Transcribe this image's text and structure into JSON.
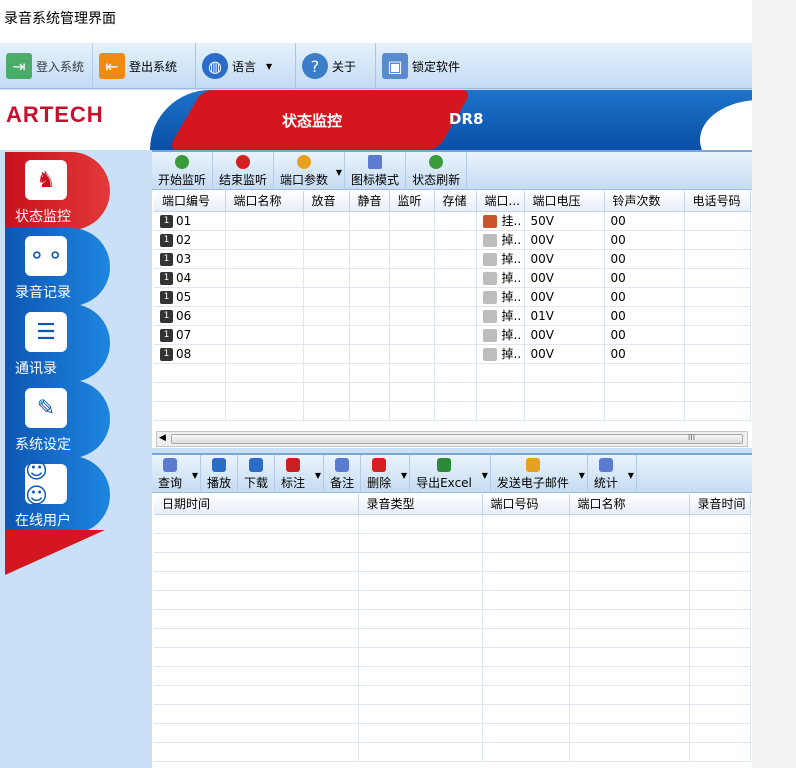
{
  "window_title": "录音系统管理界面",
  "main_toolbar": [
    {
      "label": "登入系统",
      "icon": "login-icon",
      "color": "#1e9a3a"
    },
    {
      "label": "登出系统",
      "icon": "logout-icon",
      "color": "#f08a10"
    },
    {
      "label": "语言",
      "icon": "globe-icon",
      "color": "#2a6cc8"
    },
    {
      "label": "关于",
      "icon": "help-icon",
      "color": "#3b7dc9"
    },
    {
      "label": "锁定软件",
      "icon": "lock-computer-icon",
      "color": "#5a8bd0"
    }
  ],
  "banner": {
    "logo": "ARTECH",
    "section": "状态监控",
    "model": "DR8"
  },
  "sidebar": [
    {
      "label": "状态监控",
      "icon": "status-monitor-icon"
    },
    {
      "label": "录音记录",
      "icon": "tape-icon"
    },
    {
      "label": "通讯录",
      "icon": "contacts-icon"
    },
    {
      "label": "系统设定",
      "icon": "wrench-icon"
    },
    {
      "label": "在线用户",
      "icon": "users-icon"
    }
  ],
  "monitor_toolbar": [
    {
      "label": "开始监听",
      "icon": "headset-icon",
      "color": "#3a9b3a"
    },
    {
      "label": "结束监听",
      "icon": "stop-icon",
      "color": "#d42020"
    },
    {
      "label": "端口参数",
      "icon": "gear-icon",
      "color": "#e8a020"
    },
    {
      "label": "图标模式",
      "icon": "icon-mode-icon",
      "color": "#5a7bd0"
    },
    {
      "label": "状态刷新",
      "icon": "refresh-icon",
      "color": "#3a9b3a"
    }
  ],
  "port_columns": [
    "端口编号",
    "端口名称",
    "放音",
    "静音",
    "监听",
    "存储",
    "端口...",
    "端口电压",
    "铃声次数",
    "电话号码"
  ],
  "ports": [
    {
      "no": "01",
      "status": "挂..",
      "voltage": "50V",
      "rings": "00",
      "state": "on"
    },
    {
      "no": "02",
      "status": "掉..",
      "voltage": "00V",
      "rings": "00",
      "state": "off"
    },
    {
      "no": "03",
      "status": "掉..",
      "voltage": "00V",
      "rings": "00",
      "state": "off"
    },
    {
      "no": "04",
      "status": "掉..",
      "voltage": "00V",
      "rings": "00",
      "state": "off"
    },
    {
      "no": "05",
      "status": "掉..",
      "voltage": "00V",
      "rings": "00",
      "state": "off"
    },
    {
      "no": "06",
      "status": "掉..",
      "voltage": "01V",
      "rings": "00",
      "state": "off"
    },
    {
      "no": "07",
      "status": "掉..",
      "voltage": "00V",
      "rings": "00",
      "state": "off"
    },
    {
      "no": "08",
      "status": "掉..",
      "voltage": "00V",
      "rings": "00",
      "state": "off"
    }
  ],
  "scrollbar_grip": "III",
  "record_toolbar": [
    {
      "label": "查询",
      "icon": "search-icon",
      "color": "#5a7bd0",
      "caret": true
    },
    {
      "label": "播放",
      "icon": "play-icon",
      "color": "#2a6cc8",
      "caret": false
    },
    {
      "label": "下载",
      "icon": "download-icon",
      "color": "#2a6cc8",
      "caret": false
    },
    {
      "label": "标注",
      "icon": "flag-icon",
      "color": "#c82020",
      "caret": true
    },
    {
      "label": "备注",
      "icon": "note-icon",
      "color": "#5a7bd0",
      "caret": false
    },
    {
      "label": "删除",
      "icon": "delete-icon",
      "color": "#d42020",
      "caret": true
    },
    {
      "label": "导出Excel",
      "icon": "excel-icon",
      "color": "#2a8a3a",
      "caret": true
    },
    {
      "label": "发送电子邮件",
      "icon": "email-icon",
      "color": "#e8a020",
      "caret": true
    },
    {
      "label": "统计",
      "icon": "statistics-icon",
      "color": "#5a7bd0",
      "caret": true
    }
  ],
  "record_columns": [
    "日期时间",
    "录音类型",
    "端口号码",
    "端口名称",
    "录音时间"
  ]
}
